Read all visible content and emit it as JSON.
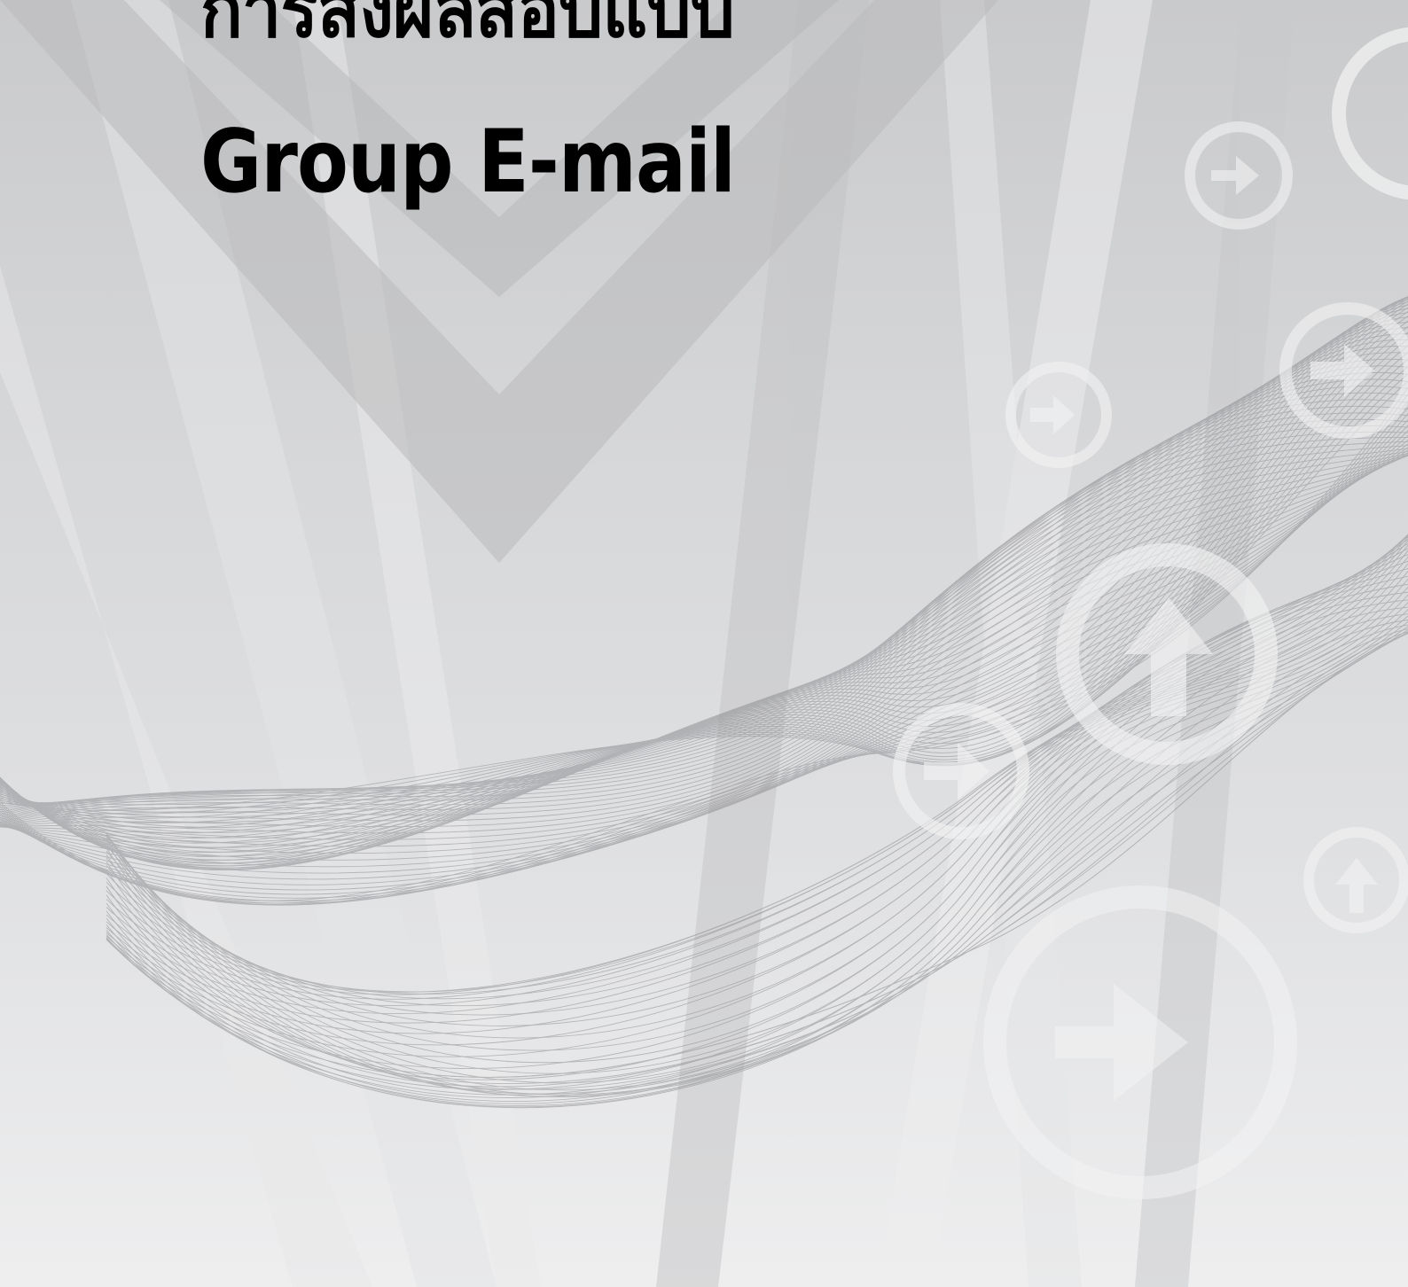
{
  "cover": {
    "title_line_1": "การส่งผลสอบแบบ",
    "title_line_2": "Group E-mail"
  },
  "colors": {
    "background_top": "#c9cacc",
    "background_bottom": "#eeeeef",
    "title_text": "#000000",
    "wave_lines": "#8e8f92",
    "icon_rings": "#f2f2f3"
  },
  "icons": [
    "arrow-right-circle-icon",
    "arrow-up-circle-icon"
  ]
}
